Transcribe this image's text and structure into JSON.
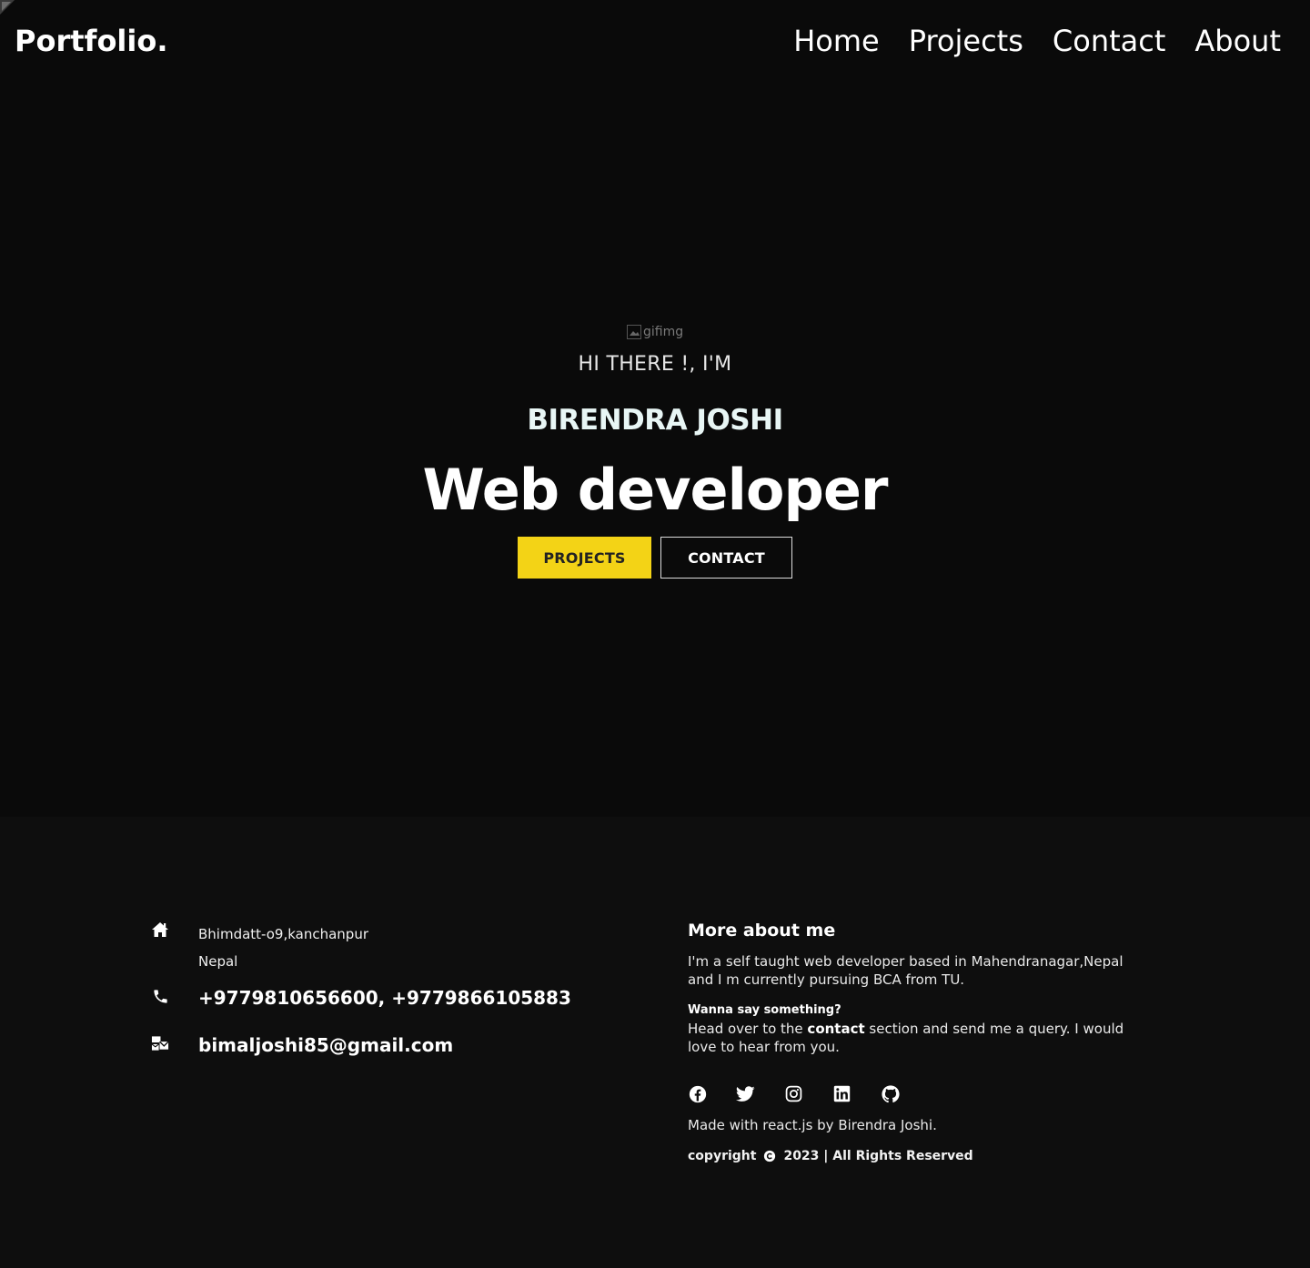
{
  "nav": {
    "brand": "Portfolio.",
    "links": [
      "Home",
      "Projects",
      "Contact",
      "About"
    ]
  },
  "hero": {
    "image_alt": "gifimg",
    "greeting": "HI THERE !, I'M",
    "name": "BIRENDRA JOSHI",
    "role": "Web developer",
    "buttons": {
      "projects": "PROJECTS",
      "contact": "CONTACT"
    }
  },
  "footer": {
    "address_line1": "Bhimdatt-o9,kanchanpur",
    "address_line2": "Nepal",
    "phone": "+9779810656600, +9779866105883",
    "email": "bimaljoshi85@gmail.com",
    "about_title": "More about me",
    "about_text": "I'm a self taught web developer based in Mahendranagar,Nepal and I m currently pursuing BCA from TU.",
    "say_title": "Wanna say something?",
    "say_prefix": "Head over to the ",
    "say_link": "contact",
    "say_suffix": " section and send me a query. I would love to hear from you.",
    "socials": [
      "facebook-icon",
      "twitter-icon",
      "instagram-icon",
      "linkedin-icon",
      "github-icon"
    ],
    "made_with": "Made with react.js by Birendra Joshi.",
    "copyright_label": "copyright",
    "copyright_text": "2023 | All Rights Reserved"
  },
  "colors": {
    "hero_bg": "#0a0a0a",
    "footer_bg": "#0e0e0e",
    "accent_yellow": "#f3d316",
    "name_tint": "#e8f6f5"
  }
}
